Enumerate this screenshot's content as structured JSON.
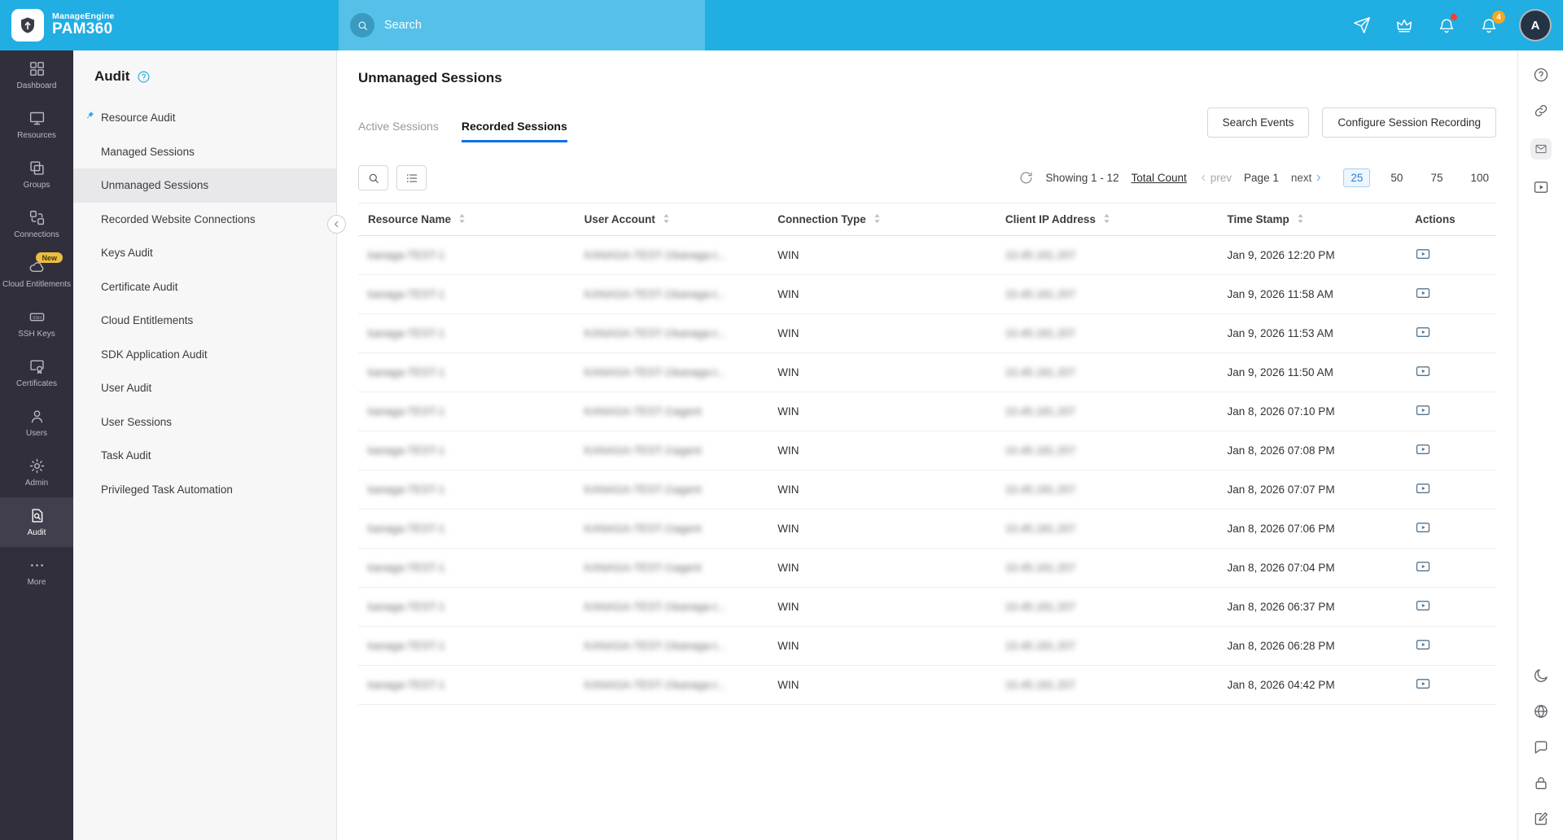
{
  "topbar": {
    "brand": {
      "company": "ManageEngine",
      "product": "PAM360",
      "logo_icon": "pam360-shield-logo"
    },
    "search": {
      "placeholder": "Search",
      "icon": "search-icon"
    },
    "icons": [
      {
        "name": "announcements-icon"
      },
      {
        "name": "license-crown-icon"
      },
      {
        "name": "alerts-bell-icon",
        "badge_dot": true
      },
      {
        "name": "notifications-bell-icon",
        "badge": "4"
      }
    ],
    "avatar": {
      "initial": "A"
    }
  },
  "left_nav": {
    "items": [
      {
        "label": "Dashboard",
        "icon": "dashboard-grid-icon"
      },
      {
        "label": "Resources",
        "icon": "resources-monitor-icon"
      },
      {
        "label": "Groups",
        "icon": "groups-icon"
      },
      {
        "label": "Connections",
        "icon": "connections-icon"
      },
      {
        "label": "Cloud Entitlements",
        "icon": "cloud-icon",
        "badge": "New"
      },
      {
        "label": "SSH Keys",
        "icon": "ssh-keys-icon"
      },
      {
        "label": "Certificates",
        "icon": "certificates-icon"
      },
      {
        "label": "Users",
        "icon": "users-icon"
      },
      {
        "label": "Admin",
        "icon": "admin-gear-icon"
      },
      {
        "label": "Audit",
        "icon": "audit-icon",
        "active": true
      },
      {
        "label": "More",
        "icon": "more-ellipsis-icon"
      }
    ]
  },
  "sidebar": {
    "title": "Audit",
    "help_icon": "help-circle-icon",
    "items": [
      {
        "label": "Resource Audit",
        "pinned": true
      },
      {
        "label": "Managed Sessions"
      },
      {
        "label": "Unmanaged Sessions",
        "active": true
      },
      {
        "label": "Recorded Website Connections"
      },
      {
        "label": "Keys Audit"
      },
      {
        "label": "Certificate Audit"
      },
      {
        "label": "Cloud Entitlements"
      },
      {
        "label": "SDK Application Audit"
      },
      {
        "label": "User Audit"
      },
      {
        "label": "User Sessions"
      },
      {
        "label": "Task Audit"
      },
      {
        "label": "Privileged Task Automation"
      }
    ]
  },
  "main": {
    "page_title": "Unmanaged Sessions",
    "tabs": [
      {
        "label": "Active Sessions",
        "active": false
      },
      {
        "label": "Recorded Sessions",
        "active": true
      }
    ],
    "actions": {
      "search_events": "Search Events",
      "configure_session_recording": "Configure Session Recording"
    },
    "toolbar_icons": [
      "table-search-icon",
      "column-chooser-icon"
    ],
    "pagination": {
      "refresh_icon": "refresh-icon",
      "showing": "Showing 1 - 12",
      "total_count_link": "Total Count",
      "prev_label": "prev",
      "page_label": "Page 1",
      "next_label": "next",
      "page_sizes": [
        "25",
        "50",
        "75",
        "100"
      ],
      "active_page_size": "25"
    },
    "table": {
      "columns": [
        {
          "label": "Resource Name",
          "sortable": true
        },
        {
          "label": "User Account",
          "sortable": true
        },
        {
          "label": "Connection Type",
          "sortable": true
        },
        {
          "label": "Client IP Address",
          "sortable": true
        },
        {
          "label": "Time Stamp",
          "sortable": true
        },
        {
          "label": "Actions",
          "sortable": false
        }
      ],
      "redacted_columns": [
        "resource_name",
        "user_account",
        "client_ip"
      ],
      "rows": [
        {
          "resource_name": "kanaga-TEST-1",
          "user_account": "KANAGA-TEST-1\\kanaga-t...",
          "connection_type": "WIN",
          "client_ip": "10.45.181.207",
          "time_stamp": "Jan 9, 2026 12:20 PM",
          "action_icon": "recorded-session-icon"
        },
        {
          "resource_name": "kanaga-TEST-1",
          "user_account": "KANAGA-TEST-1\\kanaga-t...",
          "connection_type": "WIN",
          "client_ip": "10.45.181.207",
          "time_stamp": "Jan 9, 2026 11:58 AM",
          "action_icon": "recorded-session-icon"
        },
        {
          "resource_name": "kanaga-TEST-1",
          "user_account": "KANAGA-TEST-1\\kanaga-t...",
          "connection_type": "WIN",
          "client_ip": "10.45.181.207",
          "time_stamp": "Jan 9, 2026 11:53 AM",
          "action_icon": "recorded-session-icon"
        },
        {
          "resource_name": "kanaga-TEST-1",
          "user_account": "KANAGA-TEST-1\\kanaga-t...",
          "connection_type": "WIN",
          "client_ip": "10.45.181.207",
          "time_stamp": "Jan 9, 2026 11:50 AM",
          "action_icon": "recorded-session-icon"
        },
        {
          "resource_name": "kanaga-TEST-1",
          "user_account": "KANAGA-TEST-1\\agent",
          "connection_type": "WIN",
          "client_ip": "10.45.181.207",
          "time_stamp": "Jan 8, 2026 07:10 PM",
          "action_icon": "recorded-session-icon"
        },
        {
          "resource_name": "kanaga-TEST-1",
          "user_account": "KANAGA-TEST-1\\agent",
          "connection_type": "WIN",
          "client_ip": "10.45.181.207",
          "time_stamp": "Jan 8, 2026 07:08 PM",
          "action_icon": "recorded-session-icon"
        },
        {
          "resource_name": "kanaga-TEST-1",
          "user_account": "KANAGA-TEST-1\\agent",
          "connection_type": "WIN",
          "client_ip": "10.45.181.207",
          "time_stamp": "Jan 8, 2026 07:07 PM",
          "action_icon": "recorded-session-icon"
        },
        {
          "resource_name": "kanaga-TEST-1",
          "user_account": "KANAGA-TEST-1\\agent",
          "connection_type": "WIN",
          "client_ip": "10.45.181.207",
          "time_stamp": "Jan 8, 2026 07:06 PM",
          "action_icon": "recorded-session-icon"
        },
        {
          "resource_name": "kanaga-TEST-1",
          "user_account": "KANAGA-TEST-1\\agent",
          "connection_type": "WIN",
          "client_ip": "10.45.181.207",
          "time_stamp": "Jan 8, 2026 07:04 PM",
          "action_icon": "recorded-session-icon"
        },
        {
          "resource_name": "kanaga-TEST-1",
          "user_account": "KANAGA-TEST-1\\kanaga-t...",
          "connection_type": "WIN",
          "client_ip": "10.45.181.207",
          "time_stamp": "Jan 8, 2026 06:37 PM",
          "action_icon": "recorded-session-icon"
        },
        {
          "resource_name": "kanaga-TEST-1",
          "user_account": "KANAGA-TEST-1\\kanaga-t...",
          "connection_type": "WIN",
          "client_ip": "10.45.181.207",
          "time_stamp": "Jan 8, 2026 06:28 PM",
          "action_icon": "recorded-session-icon"
        },
        {
          "resource_name": "kanaga-TEST-1",
          "user_account": "KANAGA-TEST-1\\kanaga-t...",
          "connection_type": "WIN",
          "client_ip": "10.45.181.207",
          "time_stamp": "Jan 8, 2026 04:42 PM",
          "action_icon": "recorded-session-icon"
        }
      ]
    }
  },
  "right_rail": {
    "top_icons": [
      "help-circle-icon",
      "quick-links-icon",
      "inbox-mail-icon",
      "getting-started-icon"
    ],
    "bottom_icons": [
      "dark-mode-moon-icon",
      "language-globe-icon",
      "chat-icon",
      "session-lock-icon",
      "feedback-compose-icon"
    ]
  },
  "colors": {
    "topbar": "#20aee3",
    "leftnav": "#312f3b",
    "accent_blue": "#0d6fe3",
    "badge_orange": "#f5a623",
    "new_badge_yellow": "#edbd3e"
  }
}
